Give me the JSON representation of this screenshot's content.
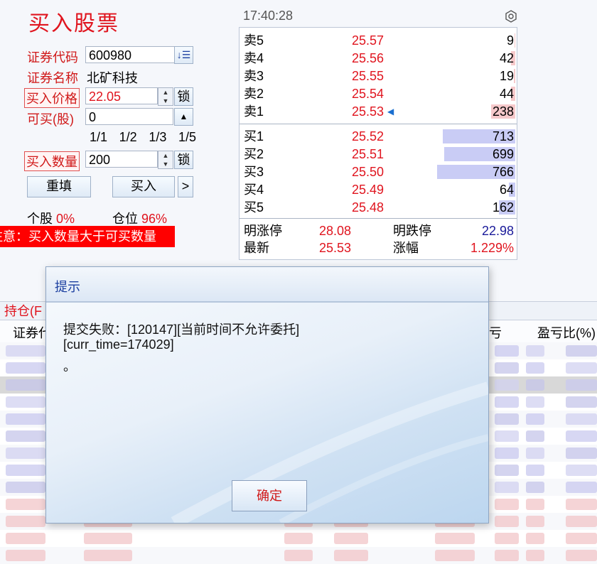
{
  "form": {
    "title": "买入股票",
    "code_label": "证券代码",
    "code_value": "600980",
    "code_btn": "↓☰",
    "name_label": "证券名称",
    "name_value": "北矿科技",
    "price_label": "买入价格",
    "price_value": "22.05",
    "lock_label": "锁",
    "buyable_label": "可买(股)",
    "buyable_value": "0",
    "fractions": [
      "1/1",
      "1/2",
      "1/3",
      "1/5"
    ],
    "qty_label": "买入数量",
    "qty_value": "200",
    "lock2_label": "锁",
    "reset_label": "重填",
    "buy_label": "买入",
    "more_label": ">",
    "single_label": "个股",
    "single_value": "0%",
    "position_label": "仓位",
    "position_value": "96%",
    "warning": "注意：买入数量大于可买数量"
  },
  "quote": {
    "time": "17:40:28",
    "settings_icon": "gear-icon",
    "sell": [
      {
        "label": "卖5",
        "price": "25.57",
        "vol": "9",
        "bar": 0.01
      },
      {
        "label": "卖4",
        "price": "25.56",
        "vol": "42",
        "bar": 0.05
      },
      {
        "label": "卖3",
        "price": "25.55",
        "vol": "19",
        "bar": 0.02
      },
      {
        "label": "卖2",
        "price": "25.54",
        "vol": "44",
        "bar": 0.05
      },
      {
        "label": "卖1",
        "price": "25.53",
        "vol": "238",
        "bar": 0.31
      }
    ],
    "buy": [
      {
        "label": "买1",
        "price": "25.52",
        "vol": "713",
        "bar": 0.93
      },
      {
        "label": "买2",
        "price": "25.51",
        "vol": "699",
        "bar": 0.91
      },
      {
        "label": "买3",
        "price": "25.50",
        "vol": "766",
        "bar": 1.0
      },
      {
        "label": "买4",
        "price": "25.49",
        "vol": "64",
        "bar": 0.08
      },
      {
        "label": "买5",
        "price": "25.48",
        "vol": "162",
        "bar": 0.21
      }
    ],
    "limit_up_label": "明涨停",
    "limit_up_value": "28.08",
    "limit_down_label": "明跌停",
    "limit_down_value": "22.98",
    "last_label": "最新",
    "last_value": "25.53",
    "change_label": "涨幅",
    "change_value": "1.229%"
  },
  "holdings": {
    "tab_label": "持仓(F",
    "col_code": "证券代",
    "col_pl": "亏",
    "col_pl_pct": "盈亏比(%)"
  },
  "dialog": {
    "title": "提示",
    "line1": "提交失败：[120147][当前时间不允许委托]",
    "line2": "[curr_time=174029]",
    "line3": "。",
    "ok_label": "确定"
  },
  "colors": {
    "accent": "#e0141e",
    "dialog_title": "#1b3fa0",
    "down": "#1a1a9a"
  }
}
